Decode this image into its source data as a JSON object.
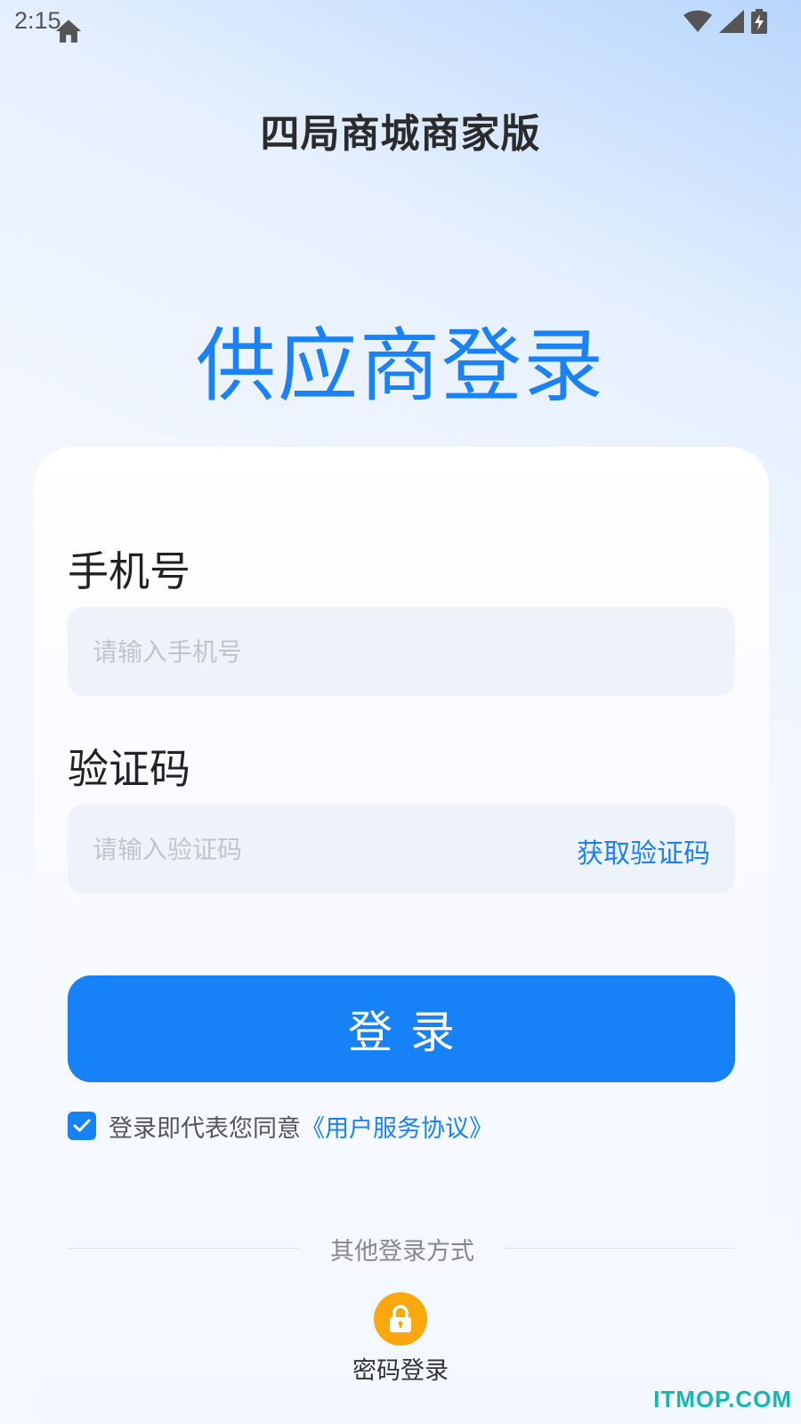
{
  "status_bar": {
    "time": "2:15",
    "icons": [
      "home-icon",
      "wifi-icon",
      "signal-icon",
      "battery-charging-icon"
    ]
  },
  "app_title": "四局商城商家版",
  "login_heading": "供应商登录",
  "form": {
    "phone_label": "手机号",
    "phone_placeholder": "请输入手机号",
    "code_label": "验证码",
    "code_placeholder": "请输入验证码",
    "get_code_label": "获取验证码",
    "login_button": "登录"
  },
  "agreement": {
    "checked": true,
    "text": "登录即代表您同意",
    "link": "《用户服务协议》"
  },
  "other_login": {
    "title": "其他登录方式",
    "password_login_label": "密码登录",
    "icon": "lock-icon"
  },
  "watermark": "ITMOP.COM",
  "colors": {
    "accent": "#1782f8",
    "heading_blue": "#1a82f5",
    "lock_orange": "#fba80f",
    "watermark": "#17b6b0"
  }
}
